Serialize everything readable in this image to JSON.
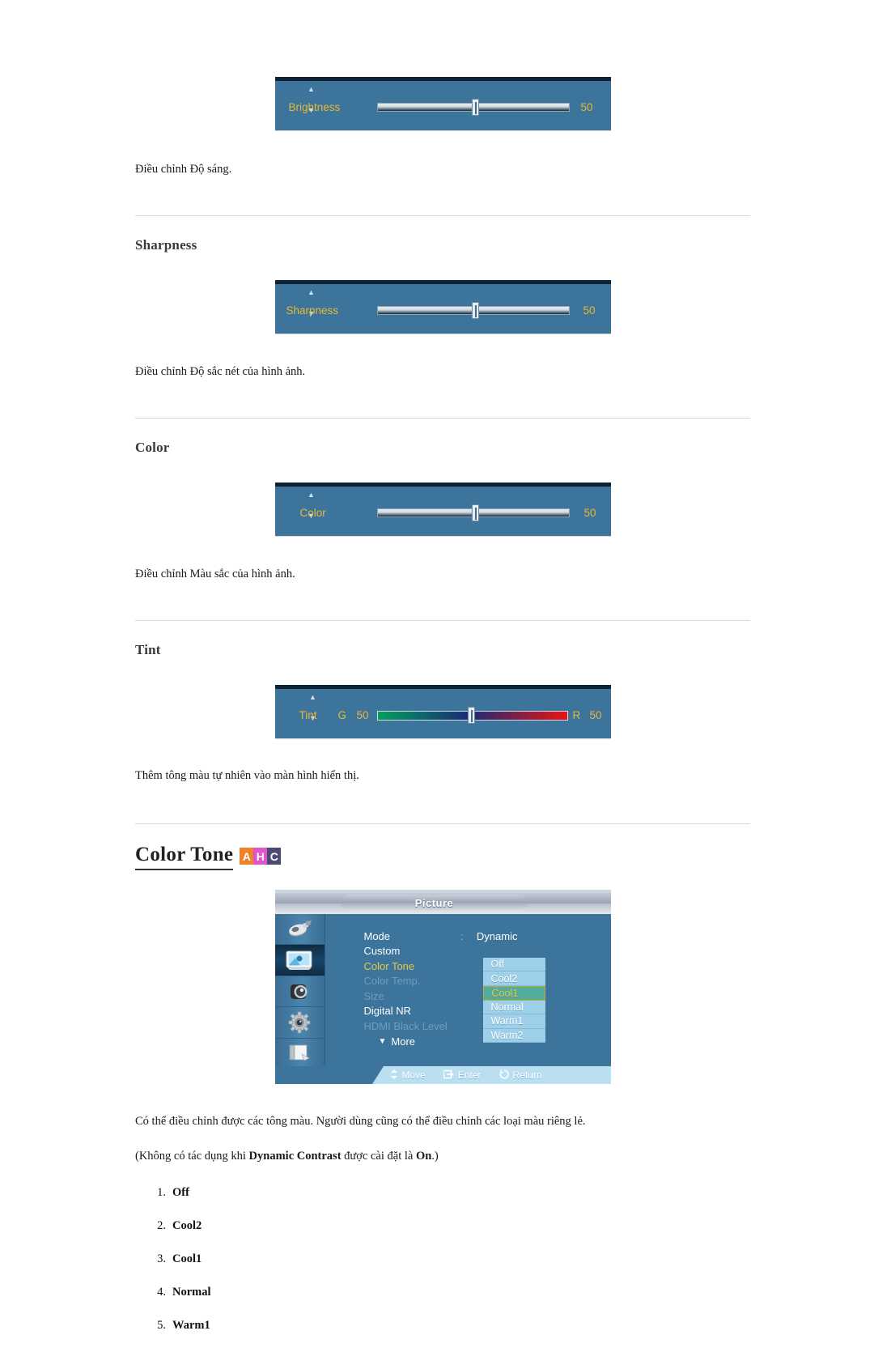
{
  "sections": {
    "brightness": {
      "slider": {
        "label": "Brightness",
        "value": "50",
        "up_arrow": "▲",
        "down_arrow": "▼"
      },
      "caption": "Điều chỉnh Độ sáng."
    },
    "sharpness": {
      "heading": "Sharpness",
      "slider": {
        "label": "Sharpness",
        "value": "50",
        "up_arrow": "▲",
        "down_arrow": "▼"
      },
      "caption": "Điều chỉnh Độ sắc nét của hình ảnh."
    },
    "color": {
      "heading": "Color",
      "slider": {
        "label": "Color",
        "value": "50",
        "up_arrow": "▲",
        "down_arrow": "▼"
      },
      "caption": "Điều chỉnh Màu sắc của hình ảnh."
    },
    "tint": {
      "heading": "Tint",
      "slider": {
        "label": "Tint",
        "g_letter": "G",
        "g_value": "50",
        "r_letter": "R",
        "r_value": "50",
        "up_arrow": "▲",
        "down_arrow": "▼",
        "gradient_from": "#00a05a",
        "gradient_mid": "#1b2a7a",
        "gradient_to": "#e81313"
      },
      "caption": "Thêm tông màu tự nhiên vào màn hình hiển thị."
    },
    "color_tone": {
      "heading": "Color Tone",
      "badges": [
        {
          "letter": "A",
          "color": "#f08128"
        },
        {
          "letter": "H",
          "color": "#e055c8"
        },
        {
          "letter": "C",
          "color": "#4a4a74"
        }
      ],
      "osd": {
        "title": "Picture",
        "sidebar_icons": [
          "input-source-icon",
          "picture-icon",
          "sound-icon",
          "setup-gear-icon",
          "multi-control-icon"
        ],
        "menu_items": [
          {
            "label": "Mode",
            "value": "Dynamic",
            "state": "normal",
            "has_colon": true
          },
          {
            "label": "Custom",
            "value": "",
            "state": "normal",
            "has_colon": false
          },
          {
            "label": "Color Tone",
            "value": "",
            "state": "selected",
            "has_colon": true
          },
          {
            "label": "Color Temp.",
            "value": "",
            "state": "dim",
            "has_colon": false
          },
          {
            "label": "Size",
            "value": "",
            "state": "dim",
            "has_colon": true
          },
          {
            "label": "Digital NR",
            "value": "",
            "state": "normal",
            "has_colon": true
          },
          {
            "label": "HDMI Black Level",
            "value": "",
            "state": "dim",
            "has_colon": true
          }
        ],
        "more_label": "More",
        "dropdown": [
          {
            "label": "Off",
            "highlighted": false
          },
          {
            "label": "Cool2",
            "highlighted": false
          },
          {
            "label": "Cool1",
            "highlighted": true
          },
          {
            "label": "Normal",
            "highlighted": false
          },
          {
            "label": "Warm1",
            "highlighted": false
          },
          {
            "label": "Warm2",
            "highlighted": false
          }
        ],
        "footer": [
          {
            "icon": "updown-arrow-icon",
            "label": "Move"
          },
          {
            "icon": "enter-icon",
            "label": "Enter"
          },
          {
            "icon": "return-icon",
            "label": "Return"
          }
        ]
      },
      "paragraph_1": "Có thể điều chỉnh được các tông màu. Người dùng cũng có thể điều chỉnh các loại màu riêng lẻ.",
      "paragraph_2_pre": "(Không có tác dụng khi ",
      "paragraph_2_bold_1": "Dynamic Contrast",
      "paragraph_2_mid": " được cài đặt là ",
      "paragraph_2_bold_2": "On",
      "paragraph_2_post": ".)",
      "options": [
        "Off",
        "Cool2",
        "Cool1",
        "Normal",
        "Warm1"
      ]
    }
  }
}
